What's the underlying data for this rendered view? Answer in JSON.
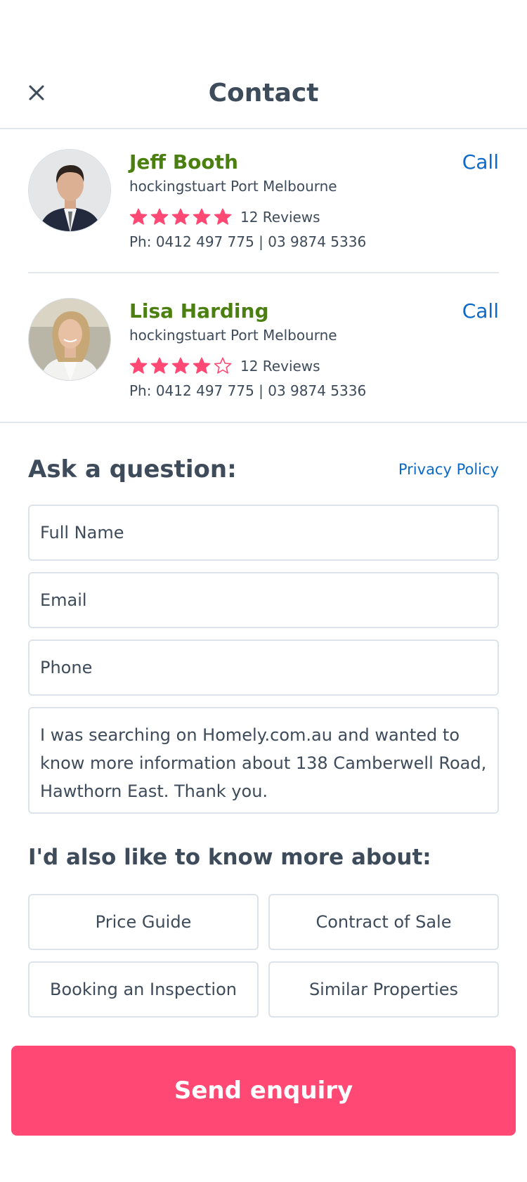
{
  "header": {
    "title": "Contact",
    "close_icon": "close-icon"
  },
  "agents": [
    {
      "name": "Jeff Booth",
      "agency": "hockingstuart Port Melbourne",
      "rating": 5,
      "max_rating": 5,
      "reviews": "12 Reviews",
      "phone": "Ph: 0412 497 775 | 03 9874 5336",
      "call_label": "Call"
    },
    {
      "name": "Lisa Harding",
      "agency": "hockingstuart Port Melbourne",
      "rating": 4,
      "max_rating": 5,
      "reviews": "12 Reviews",
      "phone": "Ph: 0412 497 775 | 03 9874 5336",
      "call_label": "Call"
    }
  ],
  "form": {
    "title": "Ask a question:",
    "privacy_label": "Privacy Policy",
    "full_name_placeholder": "Full Name",
    "email_placeholder": "Email",
    "phone_placeholder": "Phone",
    "message": "I was searching on Homely.com.au and wanted to know more information about 138 Camberwell Road, Hawthorn East. Thank you."
  },
  "more": {
    "title": "I'd also like to know more about:",
    "options": [
      "Price Guide",
      "Contract of Sale",
      "Booking an Inspection",
      "Similar Properties"
    ]
  },
  "submit_label": "Send enquiry",
  "colors": {
    "accent_pink": "#ff4874",
    "name_green": "#4b7f10",
    "link_blue": "#0b69c7",
    "text_dark": "#3d4b5a"
  }
}
